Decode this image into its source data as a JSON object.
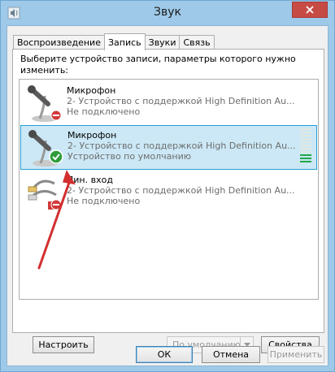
{
  "window": {
    "title": "Звук"
  },
  "tabs": [
    {
      "label": "Воспроизведение",
      "active": false
    },
    {
      "label": "Запись",
      "active": true
    },
    {
      "label": "Звуки",
      "active": false
    },
    {
      "label": "Связь",
      "active": false
    }
  ],
  "instructions": "Выберите устройство записи, параметры которого нужно изменить:",
  "devices": [
    {
      "name": "Микрофон",
      "description": "2- Устройство с поддержкой High Definition Au...",
      "status": "Не подключено",
      "icon": "microphone-icon",
      "badge": "disconnected-badge-icon",
      "selected": false
    },
    {
      "name": "Микрофон",
      "description": "2- Устройство с поддержкой High Definition Au...",
      "status": "Устройство по умолчанию",
      "icon": "microphone-icon",
      "badge": "default-check-icon",
      "selected": true,
      "level": 0.25
    },
    {
      "name": "Лин. вход",
      "description": "2- Устройство с поддержкой High Definition Au...",
      "status": "Не подключено",
      "icon": "line-in-cable-icon",
      "badge": "disconnected-badge-icon",
      "selected": false
    }
  ],
  "panel_buttons": {
    "configure": "Настроить",
    "set_default": "По умолчанию",
    "properties": "Свойства"
  },
  "dialog_buttons": {
    "ok": "ОК",
    "cancel": "Отмена",
    "apply": "Применить"
  },
  "colors": {
    "titlebar": "#9ec9e9",
    "close": "#c74b45",
    "selection": "#cce8f6",
    "selection_border": "#26a0da",
    "meter_on": "#22a84a",
    "annotation_arrow": "#d32f2f"
  }
}
